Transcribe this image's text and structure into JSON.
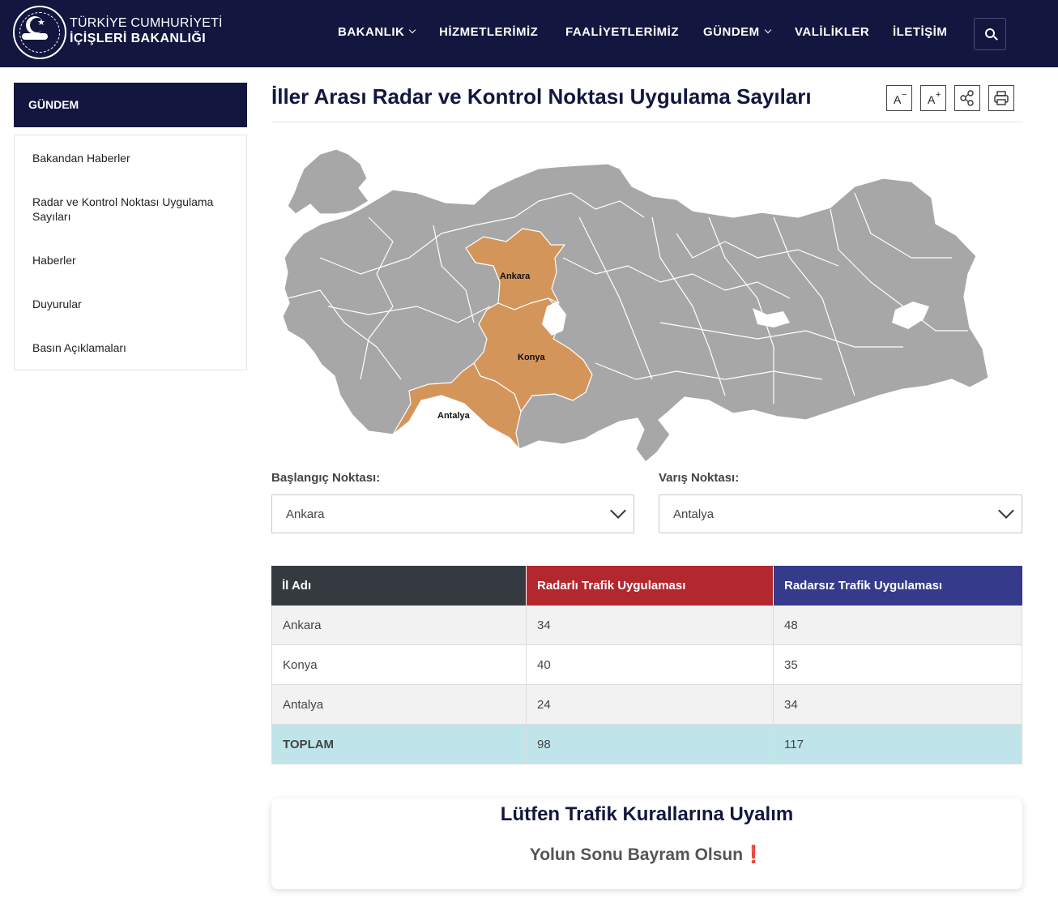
{
  "header": {
    "brand_line1": "TÜRKİYE CUMHURİYETİ",
    "brand_line2": "İÇİŞLERİ BAKANLIĞI",
    "nav": [
      {
        "label": "BAKANLIK",
        "dropdown": true
      },
      {
        "label": "HİZMETLERİMİZ",
        "dropdown": false
      },
      {
        "label": "FAALİYETLERİMİZ",
        "dropdown": false
      },
      {
        "label": "GÜNDEM",
        "dropdown": true
      },
      {
        "label": "VALİLİKLER",
        "dropdown": false
      },
      {
        "label": "İLETİŞİM",
        "dropdown": false
      }
    ],
    "search_icon": "search-icon"
  },
  "sidebar": {
    "heading": "GÜNDEM",
    "items": [
      {
        "label": "Bakandan Haberler"
      },
      {
        "label": "Radar ve Kontrol Noktası Uygulama Sayıları"
      },
      {
        "label": "Haberler"
      },
      {
        "label": "Duyurular"
      },
      {
        "label": "Basın Açıklamaları"
      }
    ]
  },
  "page": {
    "title": "İller Arası Radar ve Kontrol Noktası Uygulama Sayıları",
    "tools": {
      "font_decrease": "A",
      "font_decrease_sup": "−",
      "font_increase": "A",
      "font_increase_sup": "+",
      "share_icon": "share-icon",
      "print_icon": "print-icon"
    }
  },
  "map": {
    "labels": [
      "Ankara",
      "Konya",
      "Antalya"
    ],
    "base_color": "#a7a7a7",
    "highlight_color": "#d4955b"
  },
  "form": {
    "start_label": "Başlangıç Noktası:",
    "start_value": "Ankara",
    "end_label": "Varış Noktası:",
    "end_value": "Antalya"
  },
  "table": {
    "headers": [
      "İl Adı",
      "Radarlı Trafik Uygulaması",
      "Radarsız Trafik Uygulaması"
    ],
    "header_colors": [
      "#343a40",
      "#b3272e",
      "#363a8a"
    ],
    "rows": [
      [
        "Ankara",
        "34",
        "48"
      ],
      [
        "Konya",
        "40",
        "35"
      ],
      [
        "Antalya",
        "24",
        "34"
      ]
    ],
    "total": [
      "TOPLAM",
      "98",
      "117"
    ]
  },
  "notice": {
    "line1": "Lütfen Trafik Kurallarına Uyalım",
    "line2": "Yolun Sonu Bayram Olsun",
    "line2_mark": "❗"
  }
}
